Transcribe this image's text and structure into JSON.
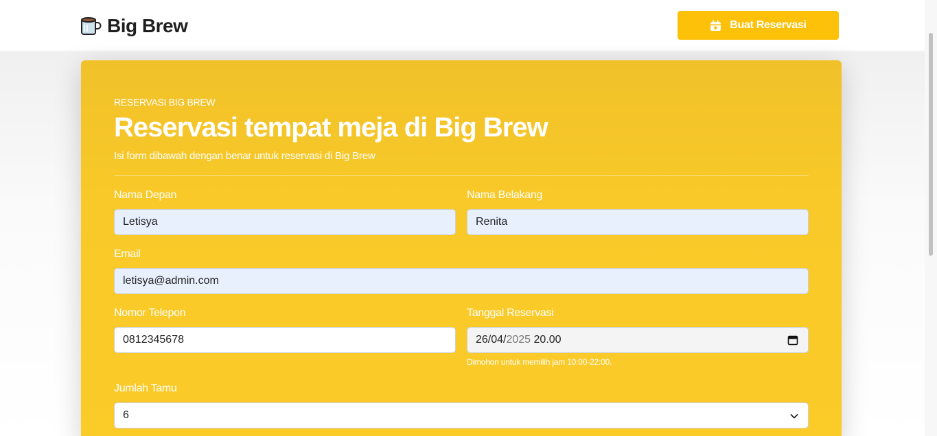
{
  "brand": {
    "name": "Big Brew",
    "icon": "coffee-mug-icon"
  },
  "header": {
    "cta_label": "Buat Reservasi",
    "cta_icon": "calendar-plus-icon"
  },
  "form": {
    "eyebrow": "RESERVASI BIG BREW",
    "title": "Reservasi tempat meja di Big Brew",
    "subtitle": "Isi form dibawah dengan benar untuk reservasi di Big Brew",
    "first_name": {
      "label": "Nama Depan",
      "value": "Letisya"
    },
    "last_name": {
      "label": "Nama Belakang",
      "value": "Renita"
    },
    "email": {
      "label": "Email",
      "value": "letisya@admin.com"
    },
    "phone": {
      "label": "Nomor Telepon",
      "value": "0812345678"
    },
    "date": {
      "label": "Tanggal Reservasi",
      "value_day_month": "26/04/",
      "value_year": "2025",
      "value_time": " 20.00",
      "hint": "Dimohon untuk memilih jam 10:00-22:00."
    },
    "guests": {
      "label": "Jumlah Tamu",
      "value": "6"
    }
  },
  "colors": {
    "accent": "#fdc10a",
    "card": "#f8c928",
    "autofill": "#e8f0fe"
  }
}
